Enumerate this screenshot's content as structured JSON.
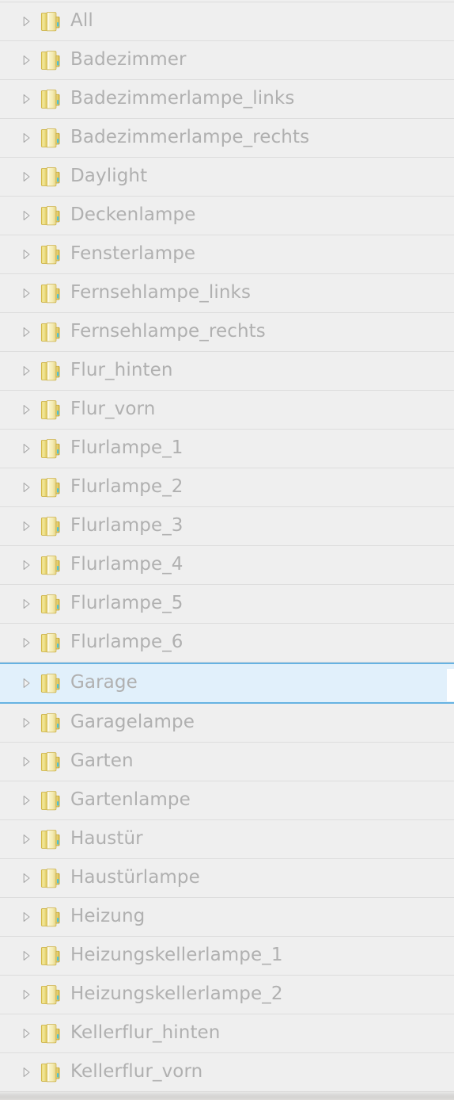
{
  "panel": {
    "kind": "tree-list",
    "colors": {
      "background": "#efefef",
      "row_divider": "#dddddd",
      "label_text": "#b0b0b0",
      "selected_fill": "#e1f0fb",
      "selected_border": "#66b2e2",
      "folder_gold": "#e8d36a",
      "folder_accent": "#4fc3d6"
    },
    "twisty_icon": "chevron-right-icon",
    "node_icon": "folder-icon",
    "selected_index": 17
  },
  "rows": [
    {
      "label": "All",
      "selected": false
    },
    {
      "label": "Badezimmer",
      "selected": false
    },
    {
      "label": "Badezimmerlampe_links",
      "selected": false
    },
    {
      "label": "Badezimmerlampe_rechts",
      "selected": false
    },
    {
      "label": "Daylight",
      "selected": false
    },
    {
      "label": "Deckenlampe",
      "selected": false
    },
    {
      "label": "Fensterlampe",
      "selected": false
    },
    {
      "label": "Fernsehlampe_links",
      "selected": false
    },
    {
      "label": "Fernsehlampe_rechts",
      "selected": false
    },
    {
      "label": "Flur_hinten",
      "selected": false
    },
    {
      "label": "Flur_vorn",
      "selected": false
    },
    {
      "label": "Flurlampe_1",
      "selected": false
    },
    {
      "label": "Flurlampe_2",
      "selected": false
    },
    {
      "label": "Flurlampe_3",
      "selected": false
    },
    {
      "label": "Flurlampe_4",
      "selected": false
    },
    {
      "label": "Flurlampe_5",
      "selected": false
    },
    {
      "label": "Flurlampe_6",
      "selected": false
    },
    {
      "label": "Garage",
      "selected": true
    },
    {
      "label": "Garagelampe",
      "selected": false
    },
    {
      "label": "Garten",
      "selected": false
    },
    {
      "label": "Gartenlampe",
      "selected": false
    },
    {
      "label": "Haustür",
      "selected": false
    },
    {
      "label": "Haustürlampe",
      "selected": false
    },
    {
      "label": "Heizung",
      "selected": false
    },
    {
      "label": "Heizungskellerlampe_1",
      "selected": false
    },
    {
      "label": "Heizungskellerlampe_2",
      "selected": false
    },
    {
      "label": "Kellerflur_hinten",
      "selected": false
    },
    {
      "label": "Kellerflur_vorn",
      "selected": false
    }
  ]
}
